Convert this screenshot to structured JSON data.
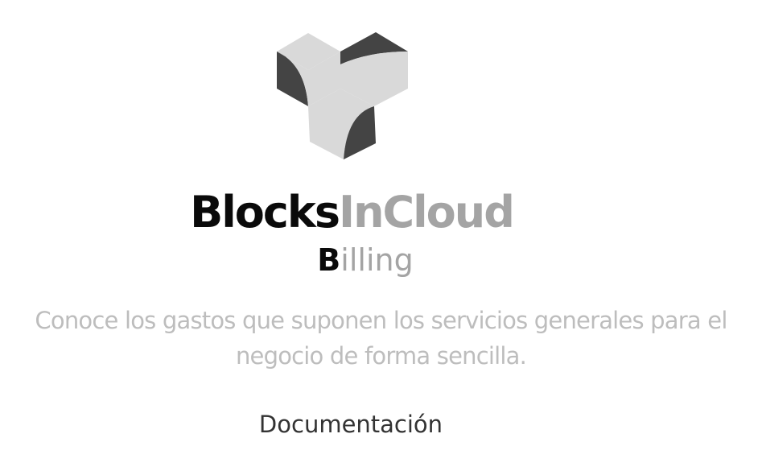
{
  "logo": {
    "icon": "blocks-cube-logo-icon",
    "colors": {
      "light": "#d9d9d9",
      "dark": "#444444"
    }
  },
  "brand": {
    "part_a": "Blocks",
    "part_b": "InCloud"
  },
  "product": {
    "initial": "B",
    "rest": "illing"
  },
  "tagline": "Conoce los gastos que suponen los servicios generales para el negocio de forma sencilla.",
  "links": {
    "documentation": "Documentación"
  },
  "colors": {
    "brand_dark": "#0a0a0a",
    "brand_gray": "#a4a4a4",
    "tagline_gray": "#bdbdbd",
    "link": "#333333"
  }
}
